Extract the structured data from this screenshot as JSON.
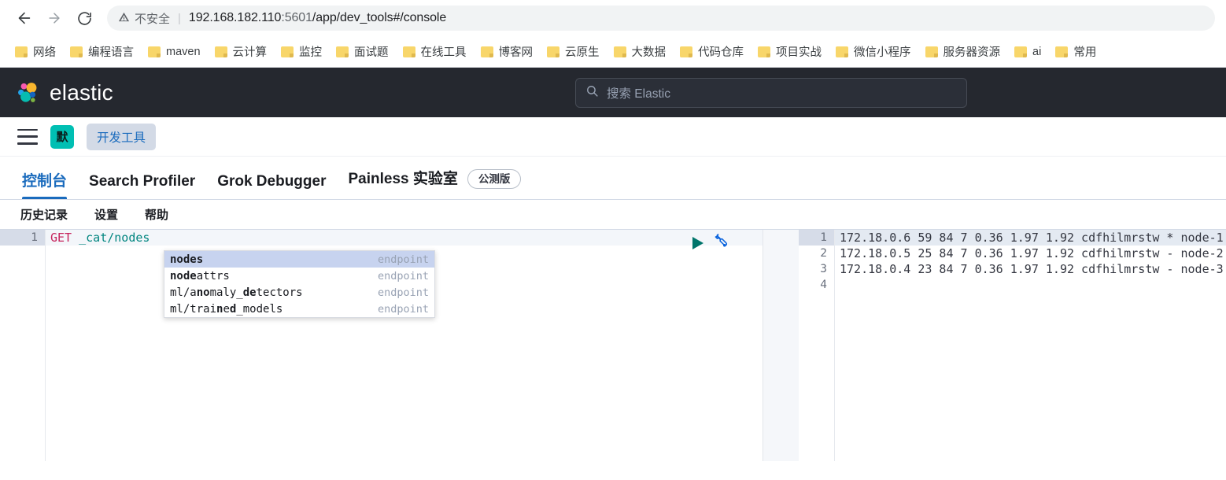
{
  "browser": {
    "back_icon": "arrow-left-icon",
    "forward_icon": "arrow-right-icon",
    "reload_icon": "reload-icon",
    "security_icon": "warning-triangle-icon",
    "security_label": "不安全",
    "separator": "|",
    "url_host": "192.168.182.110",
    "url_port": ":5601",
    "url_path": "/app/dev_tools#/console",
    "url_full": "192.168.182.110:5601/app/dev_tools#/console"
  },
  "bookmarks": [
    {
      "label": "网络"
    },
    {
      "label": "编程语言"
    },
    {
      "label": "maven"
    },
    {
      "label": "云计算"
    },
    {
      "label": "监控"
    },
    {
      "label": "面试题"
    },
    {
      "label": "在线工具"
    },
    {
      "label": "博客网"
    },
    {
      "label": "云原生"
    },
    {
      "label": "大数据"
    },
    {
      "label": "代码仓库"
    },
    {
      "label": "项目实战"
    },
    {
      "label": "微信小程序"
    },
    {
      "label": "服务器资源"
    },
    {
      "label": "ai"
    },
    {
      "label": "常用"
    }
  ],
  "header": {
    "brand": "elastic",
    "logo_icon": "elastic-logo-icon",
    "search_icon": "search-icon",
    "search_placeholder": "搜索 Elastic",
    "search_value": ""
  },
  "breadcrumb": {
    "menu_icon": "hamburger-menu-icon",
    "space_badge": "默",
    "space_badge_color": "#00bfb3",
    "current": "开发工具"
  },
  "tabs": [
    {
      "label": "控制台",
      "active": true
    },
    {
      "label": "Search Profiler",
      "active": false
    },
    {
      "label": "Grok Debugger",
      "active": false
    },
    {
      "label": "Painless 实验室",
      "active": false,
      "badge": "公测版"
    }
  ],
  "console_toolbar": [
    {
      "label": "历史记录"
    },
    {
      "label": "设置"
    },
    {
      "label": "帮助"
    }
  ],
  "editor": {
    "line_numbers": [
      "1"
    ],
    "method": "GET",
    "path": " _cat/nodes",
    "run_icon": "play-triangle-icon",
    "wrench_icon": "wrench-icon",
    "accent_play": "#00756b",
    "accent_wrench": "#0b64dd"
  },
  "autocomplete": {
    "items": [
      {
        "pre": "",
        "bold1": "nodes",
        "mid": "",
        "bold2": "",
        "post": "",
        "meta": "endpoint",
        "selected": true
      },
      {
        "pre": "",
        "bold1": "node",
        "mid": "attrs",
        "bold2": "",
        "post": "",
        "meta": "endpoint",
        "selected": false
      },
      {
        "pre": "ml/a",
        "bold1": "no",
        "mid": "maly_",
        "bold2": "de",
        "post": "tectors",
        "meta": "endpoint",
        "selected": false
      },
      {
        "pre": "ml/trai",
        "bold1": "n",
        "mid": "e",
        "bold2": "d",
        "post": "_models",
        "meta": "endpoint",
        "selected": false
      }
    ]
  },
  "response": {
    "line_numbers": [
      "1",
      "2",
      "3",
      "4"
    ],
    "lines": [
      "172.18.0.6 59 84 7 0.36 1.97 1.92 cdfhilmrstw * node-1",
      "172.18.0.5 25 84 7 0.36 1.97 1.92 cdfhilmrstw - node-2",
      "172.18.0.4 23 84 7 0.36 1.97 1.92 cdfhilmrstw - node-3",
      ""
    ]
  }
}
